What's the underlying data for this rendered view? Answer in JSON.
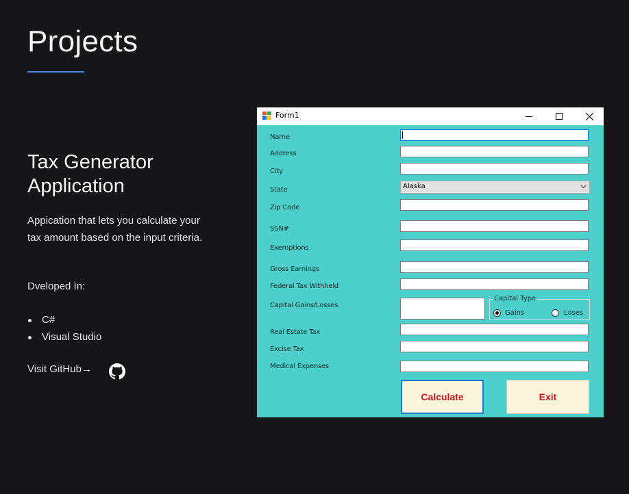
{
  "page": {
    "title": "Projects",
    "accent_color": "#4f8ef7",
    "background_color": "#161517"
  },
  "project": {
    "title": "Tax Generator Application",
    "description": "Appication that lets you calculate your tax amount based on the input criteria.",
    "developed_label": "Dveloped In:",
    "technologies": [
      "C#",
      "Visual Studio"
    ],
    "github_link": "Visit GitHub→",
    "github_icon": "github-icon"
  },
  "form": {
    "window_title": "Form1",
    "background_color": "#4dd0cc",
    "fields": {
      "name": {
        "label": "Name",
        "value": ""
      },
      "address": {
        "label": "Address",
        "value": ""
      },
      "city": {
        "label": "City",
        "value": ""
      },
      "state": {
        "label": "State",
        "value": "Alaska"
      },
      "zip": {
        "label": "Zip Code",
        "value": ""
      },
      "ssn": {
        "label": "SSN#",
        "value": ""
      },
      "exemptions": {
        "label": "Exemptions",
        "value": ""
      },
      "gross": {
        "label": "Gross Earnings",
        "value": ""
      },
      "federal": {
        "label": "Federal Tax Withheld",
        "value": ""
      },
      "capital": {
        "label": "Capital Gains/Losses",
        "value": ""
      },
      "realestate": {
        "label": "Real Estate Tax",
        "value": ""
      },
      "excise": {
        "label": "Excise Tax",
        "value": ""
      },
      "medical": {
        "label": "Medical Expenses",
        "value": ""
      }
    },
    "capital_type": {
      "title": "Capital Type",
      "options": [
        "Gains",
        "Loses"
      ],
      "selected": "Gains"
    },
    "buttons": {
      "calculate": "Calculate",
      "exit": "Exit"
    }
  }
}
